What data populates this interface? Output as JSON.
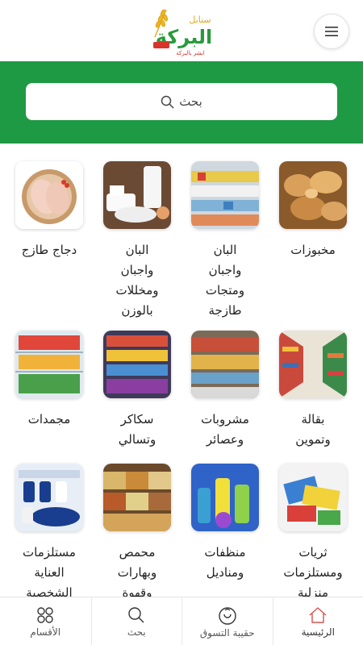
{
  "header": {
    "logo_text": "البركة",
    "logo_subtext": "سنابل",
    "logo_tagline": "ابشر بالبركة"
  },
  "search": {
    "placeholder": "بحث"
  },
  "categories": [
    {
      "label": "مخبوزات",
      "icon": "bread-image"
    },
    {
      "label": "البان\nواجبان\nومتجات\nطازجة",
      "icon": "fridge-dairy-image"
    },
    {
      "label": "البان\nواجبان\nومخللات\nبالوزن",
      "icon": "dairy-products-image"
    },
    {
      "label": "دجاج طازج",
      "icon": "chicken-image"
    },
    {
      "label": "بقالة\nوتموين",
      "icon": "grocery-aisle-image"
    },
    {
      "label": "مشروبات\nوعصائر",
      "icon": "beverages-image"
    },
    {
      "label": "سكاكر\nوتسالي",
      "icon": "candy-image"
    },
    {
      "label": "مجمدات",
      "icon": "frozen-image"
    },
    {
      "label": "ثريات\nومستلزمات\nمنزلية",
      "icon": "household-image"
    },
    {
      "label": "منظفات\nومناديل",
      "icon": "cleaning-image"
    },
    {
      "label": "محمص\nوبهارات\nوقهوة",
      "icon": "spices-image"
    },
    {
      "label": "مستلزمات\nالعناية\nالشخصية",
      "icon": "personal-care-image"
    }
  ],
  "bottom_nav": [
    {
      "label": "الرئيسية",
      "icon": "home-icon"
    },
    {
      "label": "حقيبة التسوق",
      "icon": "shopping-bag-icon"
    },
    {
      "label": "بحث",
      "icon": "search-icon"
    },
    {
      "label": "الأقسام",
      "icon": "categories-icon"
    }
  ],
  "colors": {
    "brand_green": "#1e9a44",
    "home_icon_red": "#d9534f"
  }
}
